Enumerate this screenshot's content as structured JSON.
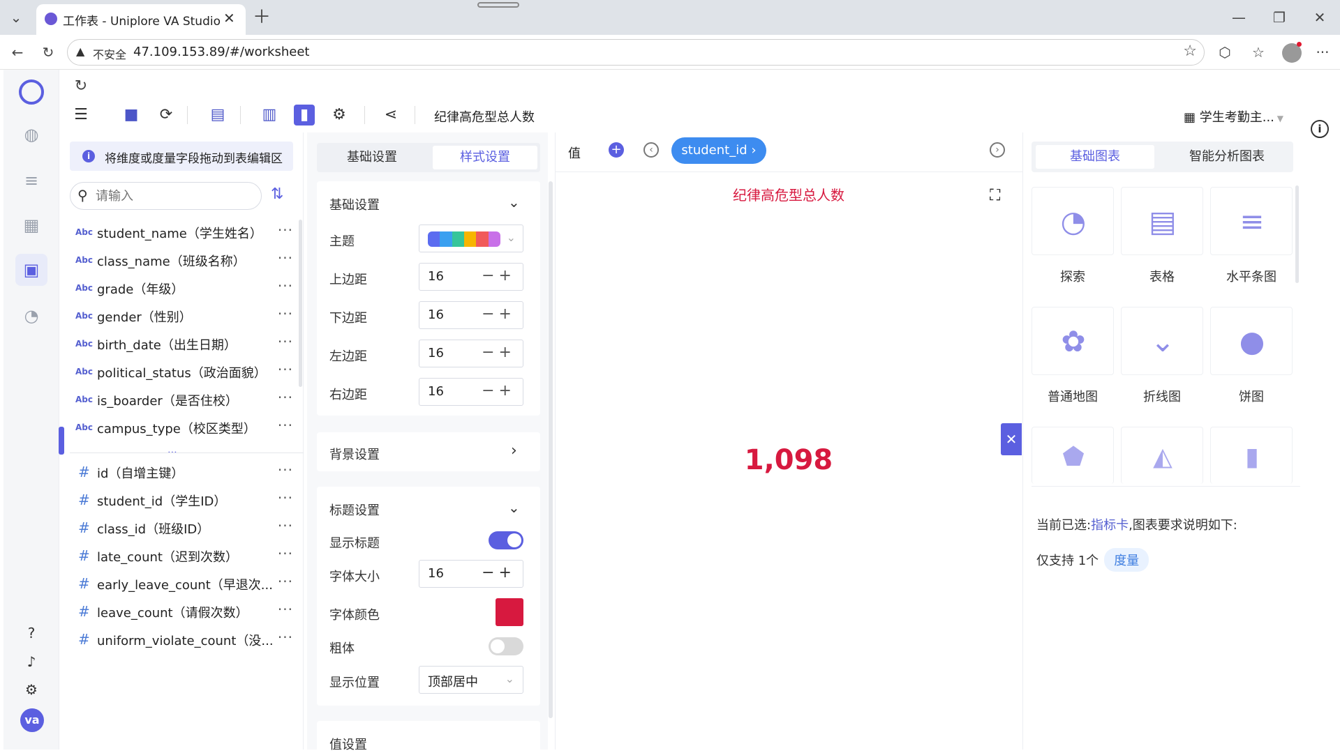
{
  "browser": {
    "tab_title": "工作表 - Uniplore VA Studio",
    "insecure_label": "不安全",
    "url": "47.109.153.89/#/worksheet"
  },
  "toolbar": {
    "sheet_title": "纪律高危型总人数",
    "dataset_name": "学生考勤主..."
  },
  "left_panel": {
    "hint": "将维度或度量字段拖动到表编辑区",
    "search_placeholder": "请输入",
    "dim_tag": "Abc",
    "dimensions": [
      "student_name（学生姓名）",
      "class_name（班级名称）",
      "grade（年级）",
      "gender（性别）",
      "birth_date（出生日期）",
      "political_status（政治面貌）",
      "is_boarder（是否住校）",
      "campus_type（校区类型）"
    ],
    "measures": [
      "id（自增主键）",
      "student_id（学生ID）",
      "class_id（班级ID）",
      "late_count（迟到次数）",
      "early_leave_count（早退次...",
      "leave_count（请假次数）",
      "uniform_violate_count（没..."
    ],
    "more": "···"
  },
  "middle_panel": {
    "tabs": [
      "基础设置",
      "样式设置"
    ],
    "basic_section": "基础设置",
    "theme_label": "主题",
    "margins": [
      {
        "label": "上边距",
        "value": "16"
      },
      {
        "label": "下边距",
        "value": "16"
      },
      {
        "label": "左边距",
        "value": "16"
      },
      {
        "label": "右边距",
        "value": "16"
      }
    ],
    "background_section": "背景设置",
    "title_section": "标题设置",
    "show_title_label": "显示标题",
    "font_size_label": "字体大小",
    "font_size_value": "16",
    "font_color_label": "字体颜色",
    "font_color": "#d7193f",
    "bold_label": "粗体",
    "position_label": "显示位置",
    "position_value": "顶部居中",
    "next_section": "值设置",
    "theme_colors": [
      "#5b6cf0",
      "#3aa0f0",
      "#36c59a",
      "#f7b500",
      "#f15a5a",
      "#c870e8"
    ]
  },
  "canvas": {
    "value_label": "值",
    "pill": "student_id",
    "chart_title": "纪律高危型总人数",
    "value": "1,098"
  },
  "right_panel": {
    "tabs": [
      "基础图表",
      "智能分析图表"
    ],
    "charts": [
      "探索",
      "表格",
      "水平条图",
      "普通地图",
      "折线图",
      "饼图"
    ],
    "selected_prefix": "当前已选:",
    "selected_chart": "指标卡",
    "selected_suffix": ",图表要求说明如下:",
    "requirement_prefix": "仅支持 1个",
    "requirement_badge": "度量"
  },
  "leftnav": {
    "avatar": "va"
  },
  "colors": {
    "accent": "#5b5fe0",
    "highlight": "#d7193f",
    "pill": "#3d8cf0"
  }
}
